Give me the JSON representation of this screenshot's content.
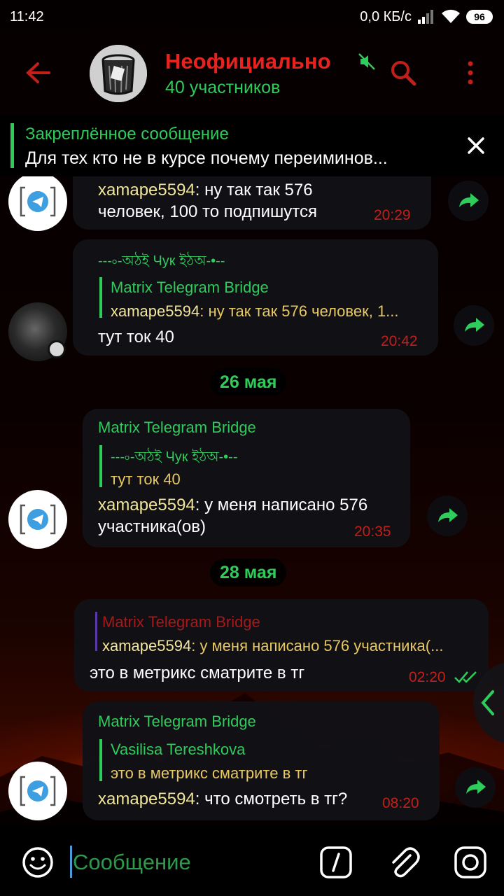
{
  "status": {
    "time": "11:42",
    "speed": "0,0 КБ/с",
    "battery": "96"
  },
  "header": {
    "title": "Неофициально",
    "subtitle": "40 участников"
  },
  "pinned": {
    "title": "Закреплённое сообщение",
    "text": "Для тех кто не в курсе почему переиминов..."
  },
  "messages": {
    "m1": {
      "nick": "xamape5594",
      "line1": ": ну так так 576",
      "line2": "человек, 100 то подпишутся",
      "time": "20:29"
    },
    "m2": {
      "sender": "---৹-অঠই Чук ইঠঅ-•--",
      "reply_name": "Matrix Telegram Bridge",
      "reply_nick": "xamape5594",
      "reply_text": ": ну так так 576 человек, 1...",
      "text": "тут ток 40",
      "time": "20:42"
    },
    "date1": "26 мая",
    "m3": {
      "sender": "Matrix Telegram Bridge",
      "reply_name": "---৹-অঠই Чук ইঠঅ-•--",
      "reply_text": "тут ток 40",
      "nick": "xamape5594",
      "line1": ": у меня написано 576",
      "line2": "участника(ов)",
      "time": "20:35"
    },
    "date2": "28 мая",
    "m4": {
      "reply_name": "Matrix Telegram Bridge",
      "reply_nick": "xamape5594",
      "reply_text": ": у меня написано 576 участника(...",
      "text": "это в метрикс сматрите в тг",
      "time": "02:20"
    },
    "m5": {
      "sender": "Matrix Telegram Bridge",
      "reply_name": "Vasilisa Tereshkova",
      "reply_text": "это в метрикс сматрите в тг",
      "nick": "xamape5594",
      "line1": ": что смотреть в тг?",
      "time": "08:20"
    }
  },
  "input": {
    "placeholder": "Сообщение"
  },
  "colors": {
    "accent_red": "#e8231f",
    "accent_green": "#2ecc5a",
    "nick_yellow": "#f1e59a",
    "time_red": "#c21f1b"
  }
}
